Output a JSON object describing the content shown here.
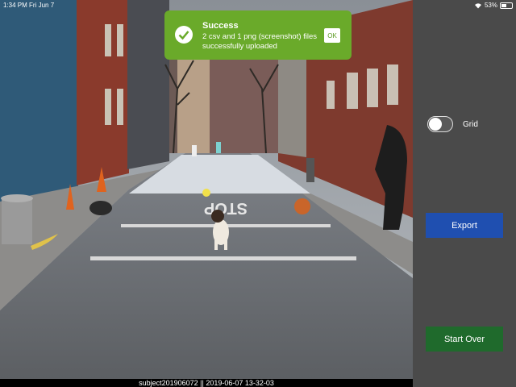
{
  "status_bar": {
    "time": "1:34 PM  Fri Jun 7",
    "battery": "53%",
    "battery_level": 0.53
  },
  "toast": {
    "title": "Success",
    "message": "2 csv and 1 png (screenshot) files successfully uploaded",
    "ok_label": "OK",
    "color": "#6aaa2a"
  },
  "scene": {
    "road_sign_text": "STOP"
  },
  "caption": "subject201906072 || 2019-06-07 13-32-03",
  "panel": {
    "grid_label": "Grid",
    "grid_enabled": false,
    "export_label": "Export",
    "start_over_label": "Start Over",
    "export_color": "#1f4fb0",
    "start_over_color": "#1f6a2c"
  }
}
